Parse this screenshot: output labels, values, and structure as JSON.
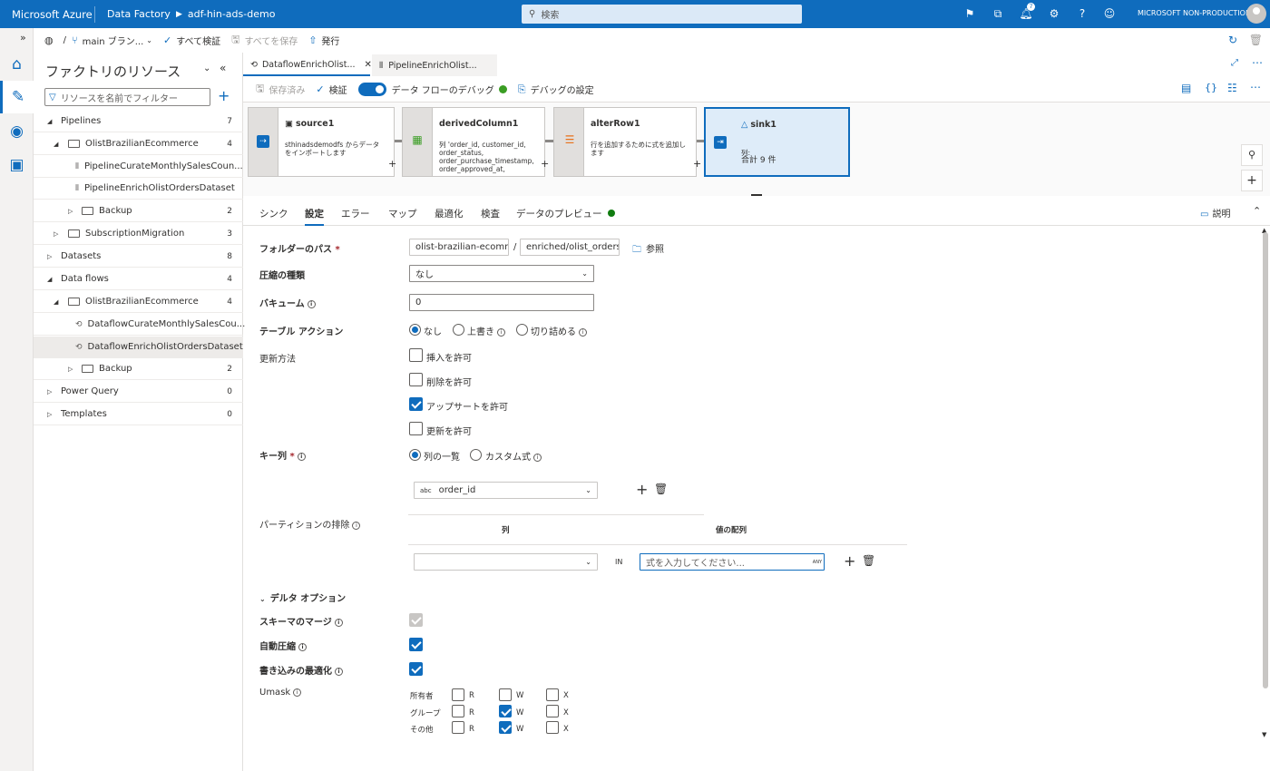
{
  "topbar": {
    "brand": "Microsoft Azure",
    "service": "Data Factory",
    "factory": "adf-hin-ads-demo",
    "search_placeholder": "検索",
    "notification_count": "7",
    "account": "MICROSOFT NON-PRODUCTION"
  },
  "cmdbar": {
    "branch": "main ブラン...",
    "validate_all": "すべて検証",
    "save_all": "すべてを保存",
    "publish": "発行"
  },
  "resources": {
    "title": "ファクトリのリソース",
    "filter_placeholder": "リソースを名前でフィルター",
    "tree": [
      {
        "label": "Pipelines",
        "count": "7"
      },
      {
        "label": "OlistBrazilianEcommerce",
        "count": "4"
      },
      {
        "label": "PipelineCurateMonthlySalesCoun...",
        "count": ""
      },
      {
        "label": "PipelineEnrichOlistOrdersDataset",
        "count": ""
      },
      {
        "label": "Backup",
        "count": "2"
      },
      {
        "label": "SubscriptionMigration",
        "count": "3"
      },
      {
        "label": "Datasets",
        "count": "8"
      },
      {
        "label": "Data flows",
        "count": "4"
      },
      {
        "label": "OlistBrazilianEcommerce",
        "count": "4"
      },
      {
        "label": "DataflowCurateMonthlySalesCou...",
        "count": ""
      },
      {
        "label": "DataflowEnrichOlistOrdersDataset",
        "count": ""
      },
      {
        "label": "Backup",
        "count": "2"
      },
      {
        "label": "Power Query",
        "count": "0"
      },
      {
        "label": "Templates",
        "count": "0"
      }
    ]
  },
  "tabs": [
    {
      "label": "DataflowEnrichOlist..."
    },
    {
      "label": "PipelineEnrichOlist..."
    }
  ],
  "toolbar2": {
    "saved": "保存済み",
    "validate": "検証",
    "debug": "データ フローのデバッグ",
    "debug_settings": "デバッグの設定"
  },
  "nodes": [
    {
      "name": "source1",
      "desc": "sthinadsdemodfs からデータをインポートします"
    },
    {
      "name": "derivedColumn1",
      "desc": "列 'order_id, customer_id, order_status, order_purchase_timestamp, order_approved_at,"
    },
    {
      "name": "alterRow1",
      "desc": "行を追加するために式を追加します"
    },
    {
      "name": "sink1",
      "desc_label": "列:",
      "desc": "合計 9 件"
    }
  ],
  "settings_tabs": [
    "シンク",
    "設定",
    "エラー",
    "マップ",
    "最適化",
    "検査",
    "データのプレビュー"
  ],
  "description_btn": "説明",
  "form": {
    "folder_path_label": "フォルダーのパス",
    "folder_path_1": "olist-brazilian-ecomm",
    "folder_sep": "/",
    "folder_path_2": "enriched/olist_orders_",
    "browse": "参照",
    "compression_label": "圧縮の種類",
    "compression_value": "なし",
    "vacuum_label": "バキューム",
    "vacuum_value": "0",
    "table_action_label": "テーブル アクション",
    "table_action_opts": [
      "なし",
      "上書き",
      "切り詰める"
    ],
    "update_method_label": "更新方法",
    "update_opts": [
      "挿入を許可",
      "削除を許可",
      "アップサートを許可",
      "更新を許可"
    ],
    "update_checked": [
      false,
      false,
      true,
      false
    ],
    "key_col_label": "キー列",
    "key_col_opts": [
      "列の一覧",
      "カスタム式"
    ],
    "key_type": "abc",
    "key_value": "order_id",
    "partition_label": "パーティションの排除",
    "col_header": "列",
    "val_header": "値の配列",
    "in_label": "IN",
    "expr_placeholder": "式を入力してください...",
    "any_label": "ANY",
    "delta_label": "デルタ オプション",
    "schema_merge_label": "スキーマのマージ",
    "auto_compact_label": "自動圧縮",
    "optimize_write_label": "書き込みの最適化",
    "umask_label": "Umask",
    "umask_rows": [
      {
        "label": "所有者",
        "r": false,
        "w": false,
        "x": false
      },
      {
        "label": "グループ",
        "r": false,
        "w": true,
        "x": false
      },
      {
        "label": "その他",
        "r": false,
        "w": true,
        "x": false
      }
    ],
    "perm_r": "R",
    "perm_w": "W",
    "perm_x": "X"
  }
}
